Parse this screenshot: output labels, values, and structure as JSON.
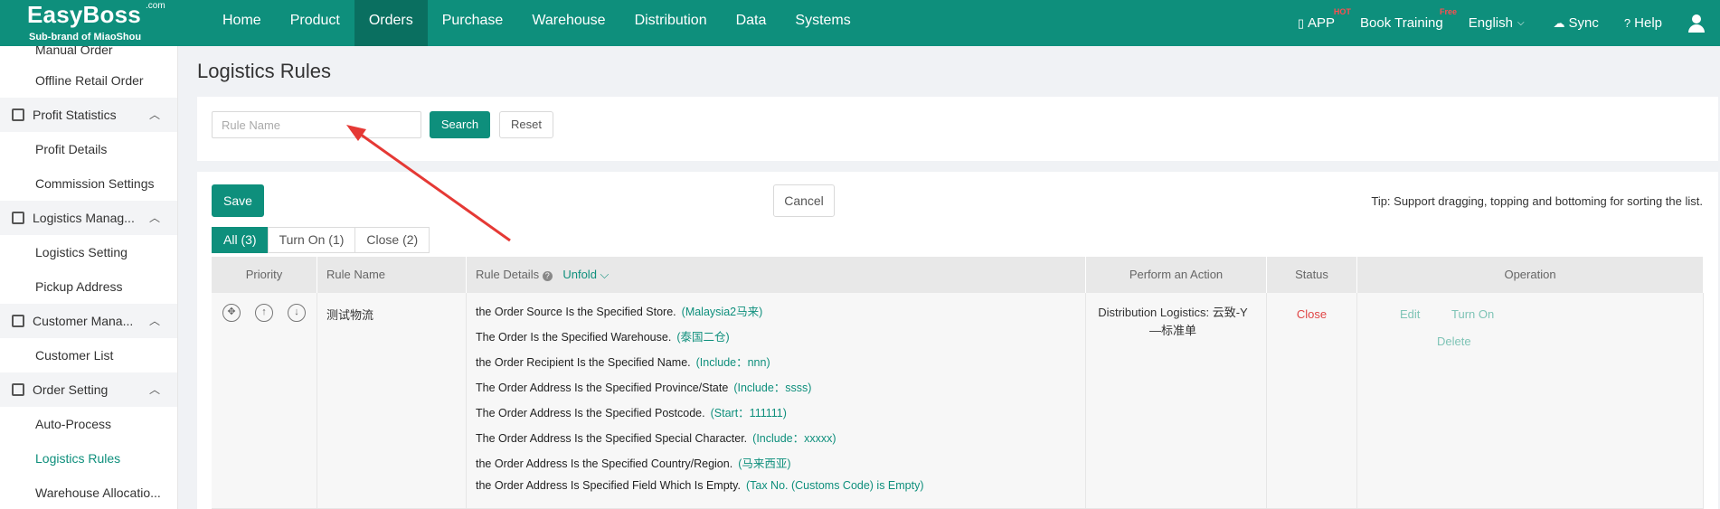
{
  "topbar": {
    "brand": "EasyBoss",
    "brand_suffix": ".com",
    "sub_brand": "Sub-brand of MiaoShou",
    "nav": [
      "Home",
      "Product",
      "Orders",
      "Purchase",
      "Warehouse",
      "Distribution",
      "Data",
      "Systems"
    ],
    "active_nav": "Orders",
    "right": {
      "app": "APP",
      "app_badge": "HOT",
      "training": "Book Training",
      "training_badge": "Free",
      "language": "English",
      "sync": "Sync",
      "help": "Help"
    }
  },
  "sidebar": {
    "items": [
      {
        "label": "Manual Order",
        "type": "sub"
      },
      {
        "label": "Offline Retail Order",
        "type": "sub"
      },
      {
        "label": "Profit Statistics",
        "type": "group"
      },
      {
        "label": "Profit Details",
        "type": "sub"
      },
      {
        "label": "Commission Settings",
        "type": "sub"
      },
      {
        "label": "Logistics Manag...",
        "type": "group"
      },
      {
        "label": "Logistics Setting",
        "type": "sub"
      },
      {
        "label": "Pickup Address",
        "type": "sub"
      },
      {
        "label": "Customer Mana...",
        "type": "group"
      },
      {
        "label": "Customer List",
        "type": "sub"
      },
      {
        "label": "Order Setting",
        "type": "group"
      },
      {
        "label": "Auto-Process",
        "type": "sub"
      },
      {
        "label": "Logistics Rules",
        "type": "sub",
        "active": true
      },
      {
        "label": "Warehouse Allocatio...",
        "type": "sub"
      }
    ]
  },
  "page": {
    "title": "Logistics Rules",
    "search_placeholder": "Rule Name",
    "search_label": "Search",
    "reset_label": "Reset",
    "save_label": "Save",
    "cancel_label": "Cancel",
    "tip": "Tip: Support dragging, topping and bottoming for sorting the list.",
    "tabs": [
      "All (3)",
      "Turn On (1)",
      "Close (2)"
    ]
  },
  "table": {
    "headers": {
      "priority": "Priority",
      "rule_name": "Rule Name",
      "rule_details": "Rule Details",
      "unfold": "Unfold",
      "action": "Perform an Action",
      "status": "Status",
      "operation": "Operation"
    },
    "row": {
      "rule_name": "测试物流",
      "conditions": [
        {
          "text": "the Order Source Is the Specified Store.",
          "value": "(Malaysia2马来)"
        },
        {
          "text": "The Order Is the Specified Warehouse.",
          "value": "(泰国二仓)"
        },
        {
          "text": "the Order Recipient Is the Specified Name.",
          "value": "(Include：nnn)"
        },
        {
          "text": "The Order Address Is the Specified Province/State",
          "value": "(Include：ssss)"
        },
        {
          "text": "The Order Address Is the Specified Postcode.",
          "value": "(Start：111111)"
        },
        {
          "text": "The Order Address Is the Specified Special Character.",
          "value": "(Include：xxxxx)"
        },
        {
          "text": "the Order Address Is the Specified Country/Region.",
          "value": "(马来西亚)"
        },
        {
          "text": "the Order Address Is Specified Field Which Is Empty.",
          "value": "(Tax No. (Customs Code) is Empty)"
        }
      ],
      "action_line1": "Distribution Logistics: 云致-Y",
      "action_line2": "—标准单",
      "status": "Close",
      "ops": {
        "edit": "Edit",
        "turn_on": "Turn On",
        "delete": "Delete"
      }
    }
  },
  "colors": {
    "primary": "#0e8f7c",
    "danger": "#e04545",
    "annotation_arrow": "#e53935"
  }
}
